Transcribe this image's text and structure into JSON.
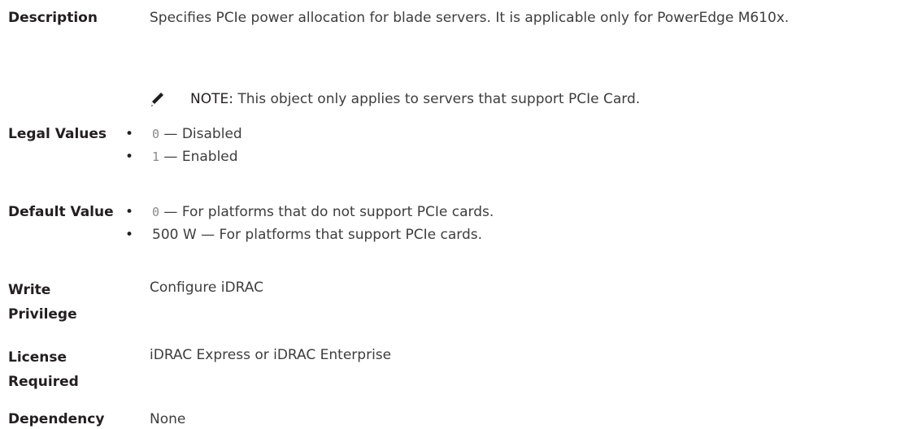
{
  "description": {
    "term": "Description",
    "text": "Specifies PCIe power allocation for blade servers. It is applicable only for PowerEdge M610x.",
    "note_label": "NOTE:",
    "note_text": " This object only applies to servers that support PCIe Card."
  },
  "legal_values": {
    "term": "Legal Values",
    "items": [
      {
        "code": "0",
        "text": " — Disabled"
      },
      {
        "code": "1",
        "text": " — Enabled"
      }
    ]
  },
  "default_value": {
    "term": "Default Value",
    "items": [
      {
        "code": "0",
        "text": " — For platforms that do not support PCIe cards."
      },
      {
        "code": "",
        "text": "500 W — For platforms that support PCIe cards."
      }
    ]
  },
  "write_privilege": {
    "term": "Write Privilege",
    "text": "Configure iDRAC"
  },
  "license_required": {
    "term": "License Required",
    "text": "iDRAC Express or iDRAC Enterprise"
  },
  "dependency": {
    "term": "Dependency",
    "text": "None"
  },
  "icons": {
    "note": "pencil-note-icon",
    "bullet": "bullet"
  }
}
